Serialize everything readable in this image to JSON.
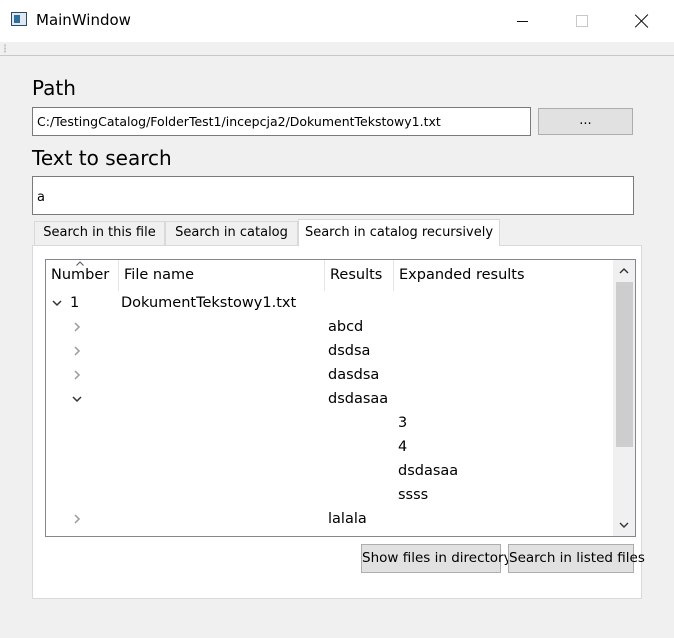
{
  "window": {
    "title": "MainWindow"
  },
  "path": {
    "label": "Path",
    "value": "C:/TestingCatalog/FolderTest1/incepcja2/DokumentTekstowy1.txt",
    "browse_label": "..."
  },
  "search": {
    "label": "Text to search",
    "value": "a"
  },
  "tabs": [
    {
      "label": "Search in this file",
      "active": false
    },
    {
      "label": "Search in catalog",
      "active": false
    },
    {
      "label": "Search in catalog recursively",
      "active": true
    }
  ],
  "tree": {
    "columns": [
      "Number",
      "File name",
      "Results",
      "Expanded results"
    ],
    "rows": [
      {
        "indent": 0,
        "chevron": "expanded",
        "number": "1",
        "file": "DokumentTekstowy1.txt",
        "result": "",
        "expanded": ""
      },
      {
        "indent": 1,
        "chevron": "collapsed",
        "number": "",
        "file": "",
        "result": "abcd",
        "expanded": ""
      },
      {
        "indent": 1,
        "chevron": "collapsed",
        "number": "",
        "file": "",
        "result": "dsdsa",
        "expanded": ""
      },
      {
        "indent": 1,
        "chevron": "collapsed",
        "number": "",
        "file": "",
        "result": "dasdsa",
        "expanded": ""
      },
      {
        "indent": 1,
        "chevron": "expanded",
        "number": "",
        "file": "",
        "result": "dsdasaa",
        "expanded": ""
      },
      {
        "indent": 2,
        "chevron": "none",
        "number": "",
        "file": "",
        "result": "",
        "expanded": "3"
      },
      {
        "indent": 2,
        "chevron": "none",
        "number": "",
        "file": "",
        "result": "",
        "expanded": "4"
      },
      {
        "indent": 2,
        "chevron": "none",
        "number": "",
        "file": "",
        "result": "",
        "expanded": "dsdasaa"
      },
      {
        "indent": 2,
        "chevron": "none",
        "number": "",
        "file": "",
        "result": "",
        "expanded": "ssss"
      },
      {
        "indent": 1,
        "chevron": "collapsed",
        "number": "",
        "file": "",
        "result": "lalala",
        "expanded": ""
      }
    ]
  },
  "buttons": {
    "show_files": "Show files in directory",
    "search_listed": "Search in listed files"
  }
}
